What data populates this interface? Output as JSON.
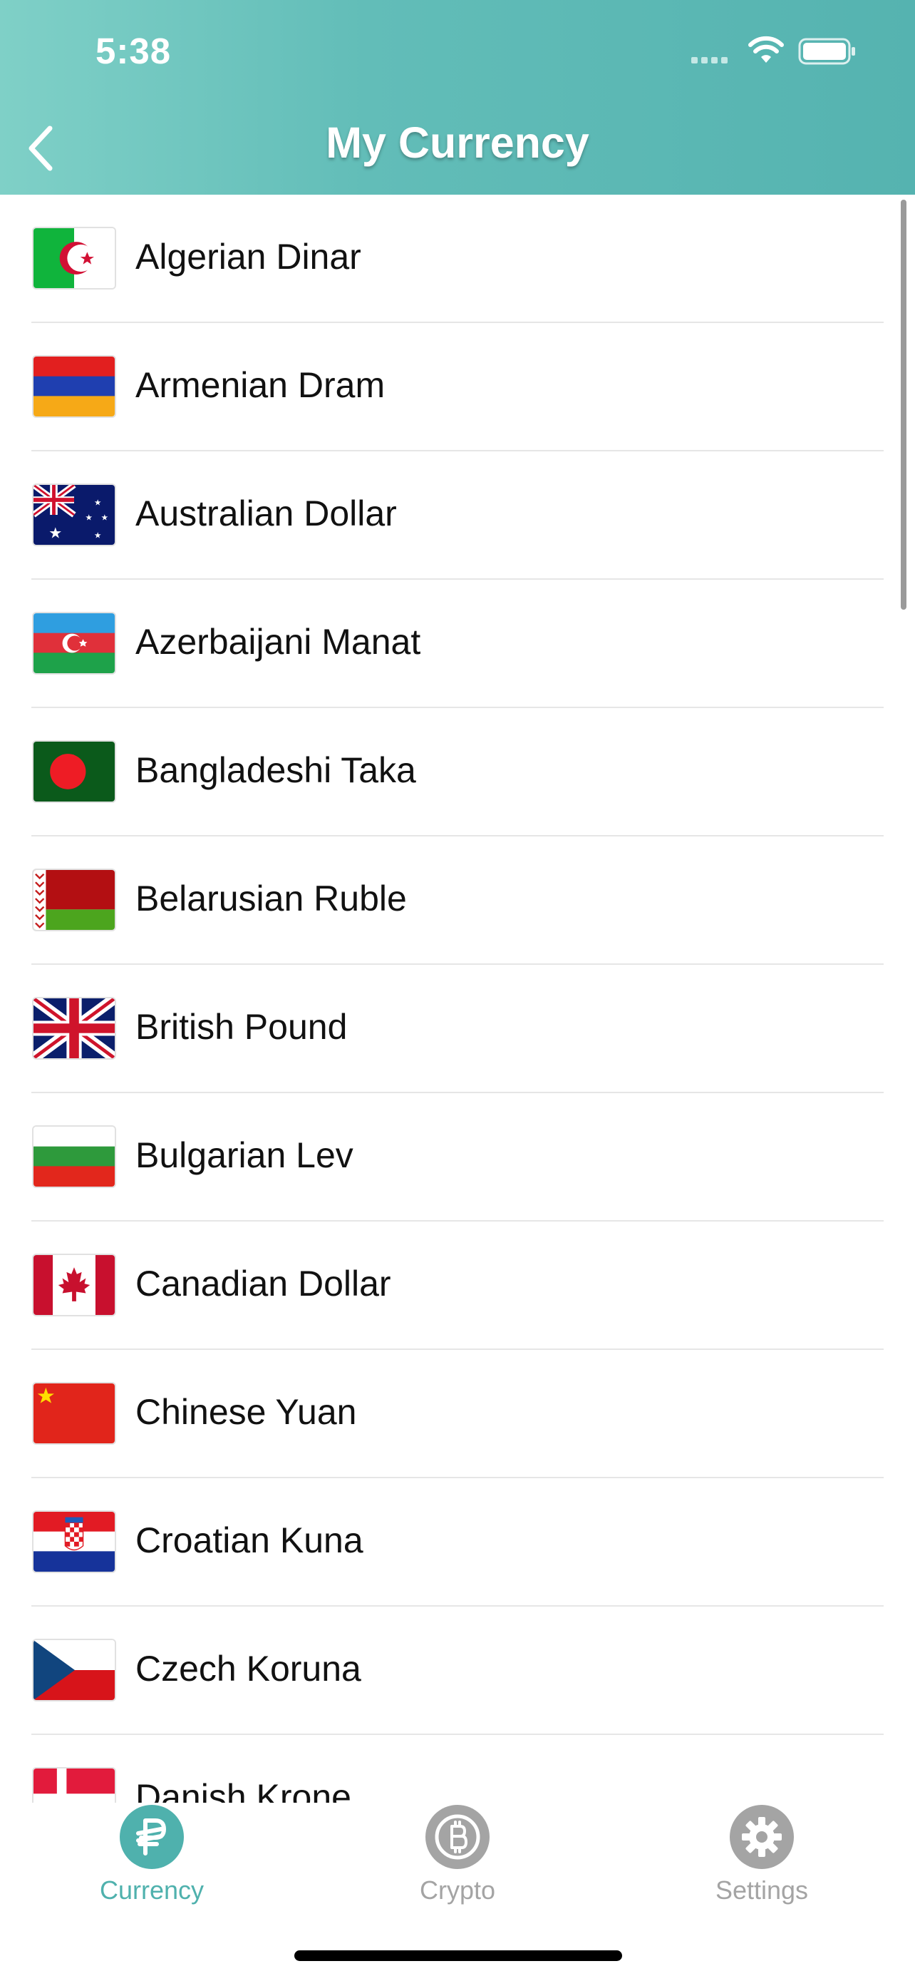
{
  "status_bar": {
    "time": "5:38"
  },
  "nav": {
    "title": "My Currency"
  },
  "currencies": [
    {
      "name": "Algerian Dinar",
      "flag": "algeria-flag"
    },
    {
      "name": "Armenian Dram",
      "flag": "armenia-flag"
    },
    {
      "name": "Australian Dollar",
      "flag": "australia-flag"
    },
    {
      "name": "Azerbaijani Manat",
      "flag": "azerbaijan-flag"
    },
    {
      "name": "Bangladeshi Taka",
      "flag": "bangladesh-flag"
    },
    {
      "name": "Belarusian Ruble",
      "flag": "belarus-flag"
    },
    {
      "name": "British Pound",
      "flag": "uk-flag"
    },
    {
      "name": "Bulgarian Lev",
      "flag": "bulgaria-flag"
    },
    {
      "name": "Canadian Dollar",
      "flag": "canada-flag"
    },
    {
      "name": "Chinese Yuan",
      "flag": "china-flag"
    },
    {
      "name": "Croatian Kuna",
      "flag": "croatia-flag"
    },
    {
      "name": "Czech Koruna",
      "flag": "czech-flag"
    },
    {
      "name": "Danish Krone",
      "flag": "denmark-flag"
    }
  ],
  "tabs": [
    {
      "label": "Currency",
      "icon": "currency-icon",
      "active": true
    },
    {
      "label": "Crypto",
      "icon": "bitcoin-icon",
      "active": false
    },
    {
      "label": "Settings",
      "icon": "gear-icon",
      "active": false
    }
  ],
  "colors": {
    "header_start": "#7fd0c7",
    "header_end": "#55b3b0",
    "tab_active": "#4fb1ad",
    "tab_inactive": "#a4a4a4"
  }
}
